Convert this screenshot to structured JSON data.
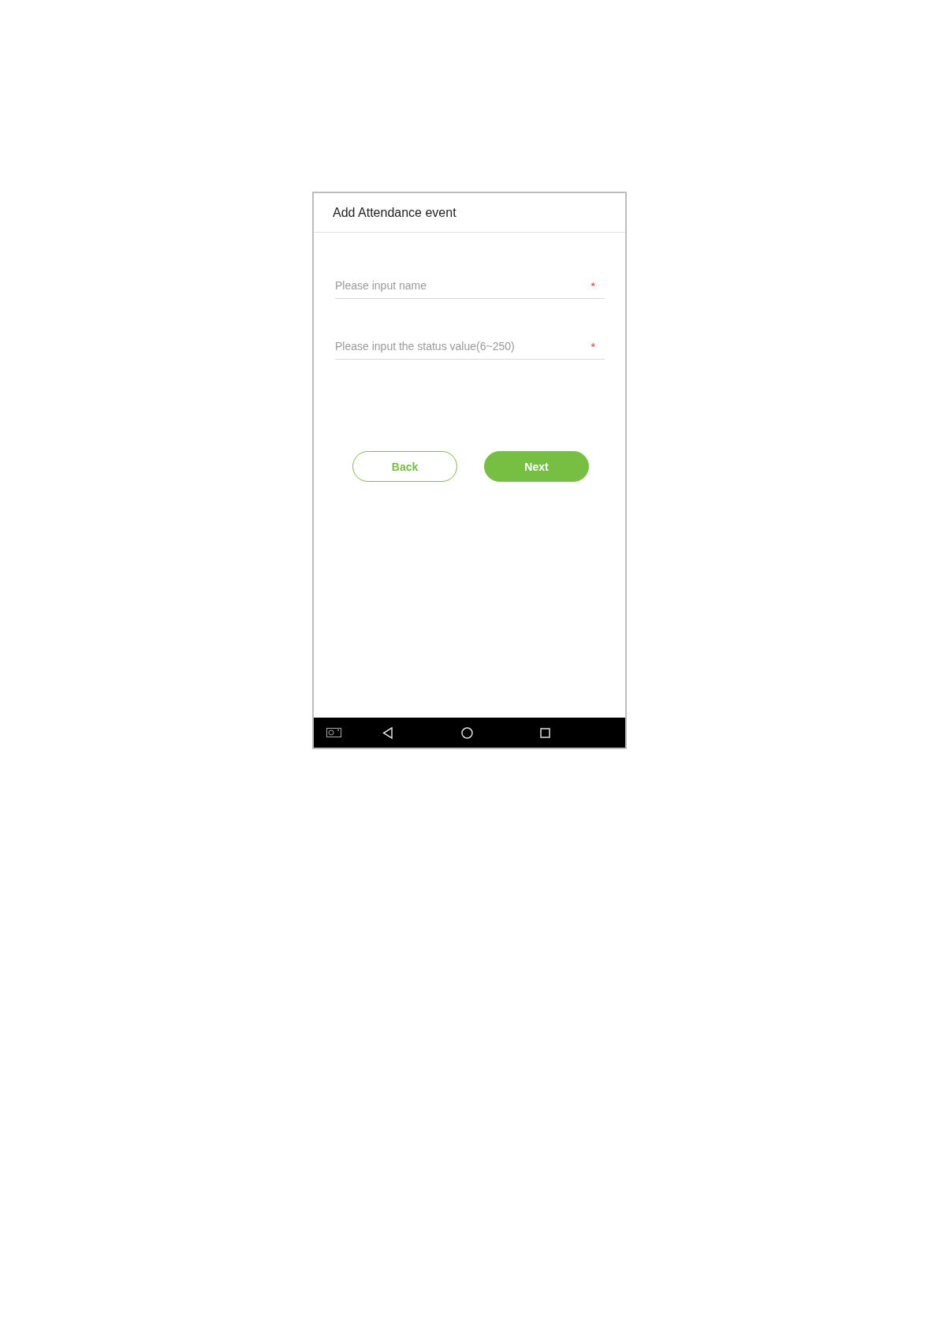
{
  "screen": {
    "title": "Add Attendance event"
  },
  "fields": [
    {
      "placeholder": "Please input name",
      "required_mark": "*"
    },
    {
      "placeholder": "Please input the status value(6~250)",
      "required_mark": "*"
    }
  ],
  "buttons": [
    {
      "label": "Back",
      "kind": "outline"
    },
    {
      "label": "Next",
      "kind": "filled"
    }
  ]
}
